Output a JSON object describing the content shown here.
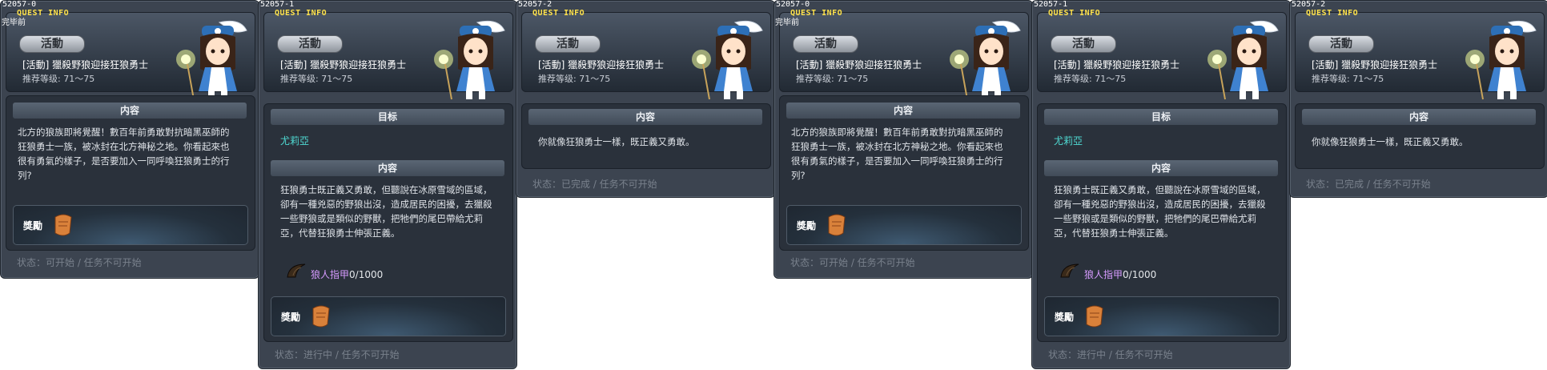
{
  "qinfo_label": "QUEST INFO",
  "badge_label": "活動",
  "quest_title": "[活動] 獵殺野狼迎接狂狼勇士",
  "level_text": "推荐等级: 71～75",
  "section_content": "内容",
  "section_goal": "目标",
  "reward_label": "獎勵",
  "panels": [
    {
      "quest_id": "52057-0",
      "stage": "完毕前",
      "intro": "北方的狼族即將覺醒！數百年前勇敢對抗暗黑巫師的狂狼勇士一族，被冰封在北方神秘之地。你看起來也很有勇氣的樣子，是否要加入一同呼喚狂狼勇士的行列?",
      "status": "状态：可开始 / 任务不可开始"
    },
    {
      "quest_id": "52057-1",
      "npc_name": "尤莉亞",
      "desc": "狂狼勇士既正義又勇敢，但聽說在冰原雪域的區域，卻有一種兇惡的野狼出沒，造成居民的困擾，去獵殺一些野狼或是類似的野獸，把牠們的尾巴帶給尤莉亞，代替狂狼勇士伸張正義。",
      "item_name": "狼人指甲",
      "item_count": "0/1000",
      "status": "状态：进行中 / 任务不可开始"
    },
    {
      "quest_id": "52057-2",
      "content": "你就像狂狼勇士一樣，既正義又勇敢。",
      "status": "状态：已完成 / 任务不可开始"
    },
    {
      "quest_id": "52057-0",
      "stage": "完毕前",
      "intro": "北方的狼族即將覺醒！數百年前勇敢對抗暗黑巫師的狂狼勇士一族，被冰封在北方神秘之地。你看起來也很有勇氣的樣子，是否要加入一同呼喚狂狼勇士的行列?",
      "status": "状态：可开始 / 任务不可开始"
    },
    {
      "quest_id": "52057-1",
      "npc_name": "尤莉亞",
      "desc": "狂狼勇士既正義又勇敢，但聽說在冰原雪域的區域，卻有一種兇惡的野狼出沒，造成居民的困擾，去獵殺一些野狼或是類似的野獸，把牠們的尾巴帶給尤莉亞，代替狂狼勇士伸張正義。",
      "item_name": "狼人指甲",
      "item_count": "0/1000",
      "status": "状态：进行中 / 任务不可开始"
    },
    {
      "quest_id": "52057-2",
      "content": "你就像狂狼勇士一樣，既正義又勇敢。",
      "status": "状态：已完成 / 任务不可开始"
    }
  ]
}
